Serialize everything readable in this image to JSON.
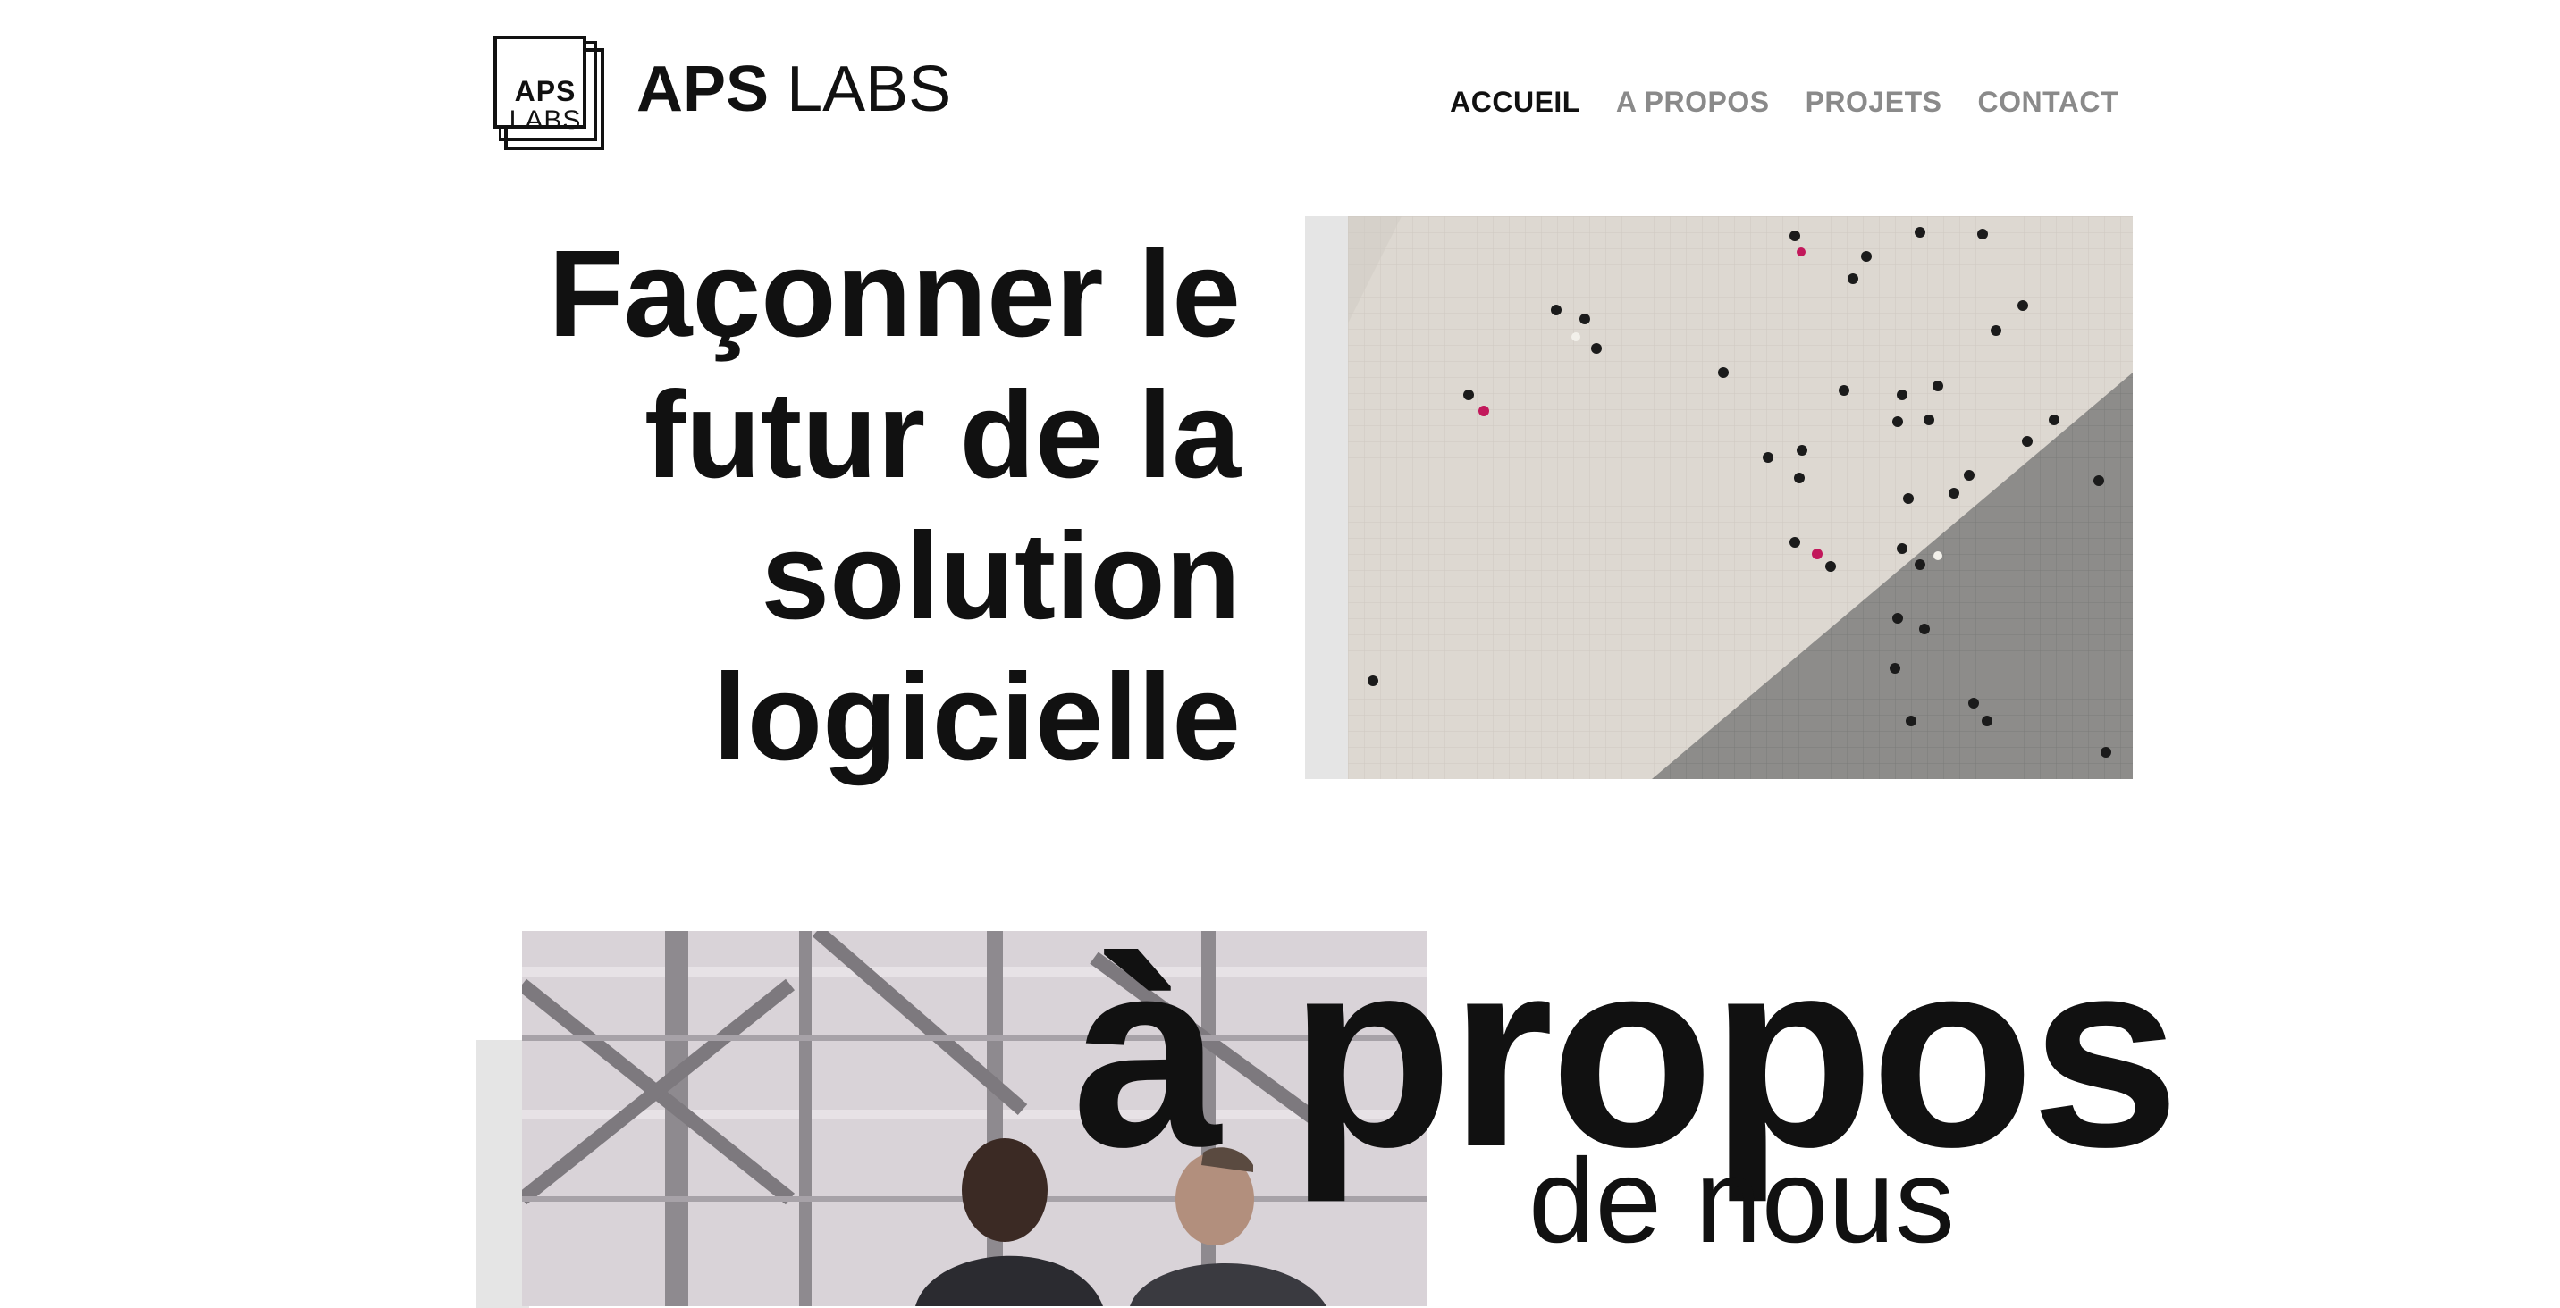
{
  "header": {
    "logo": {
      "mark_top": "APS",
      "mark_bottom": "LABS"
    },
    "brand": {
      "strong": "APS",
      "light": "LABS"
    },
    "nav": [
      {
        "label": "ACCUEIL",
        "active": true
      },
      {
        "label": "A PROPOS",
        "active": false
      },
      {
        "label": "PROJETS",
        "active": false
      },
      {
        "label": "CONTACT",
        "active": false
      }
    ]
  },
  "hero": {
    "heading_lines": [
      "Façonner le",
      "futur de la",
      "solution",
      "logicielle"
    ]
  },
  "about": {
    "title": "à propos",
    "subtitle": "de nous"
  },
  "colors": {
    "text": "#111111",
    "nav_inactive": "#8a8a8a",
    "accent_block": "#e5e5e5",
    "background": "#ffffff"
  }
}
